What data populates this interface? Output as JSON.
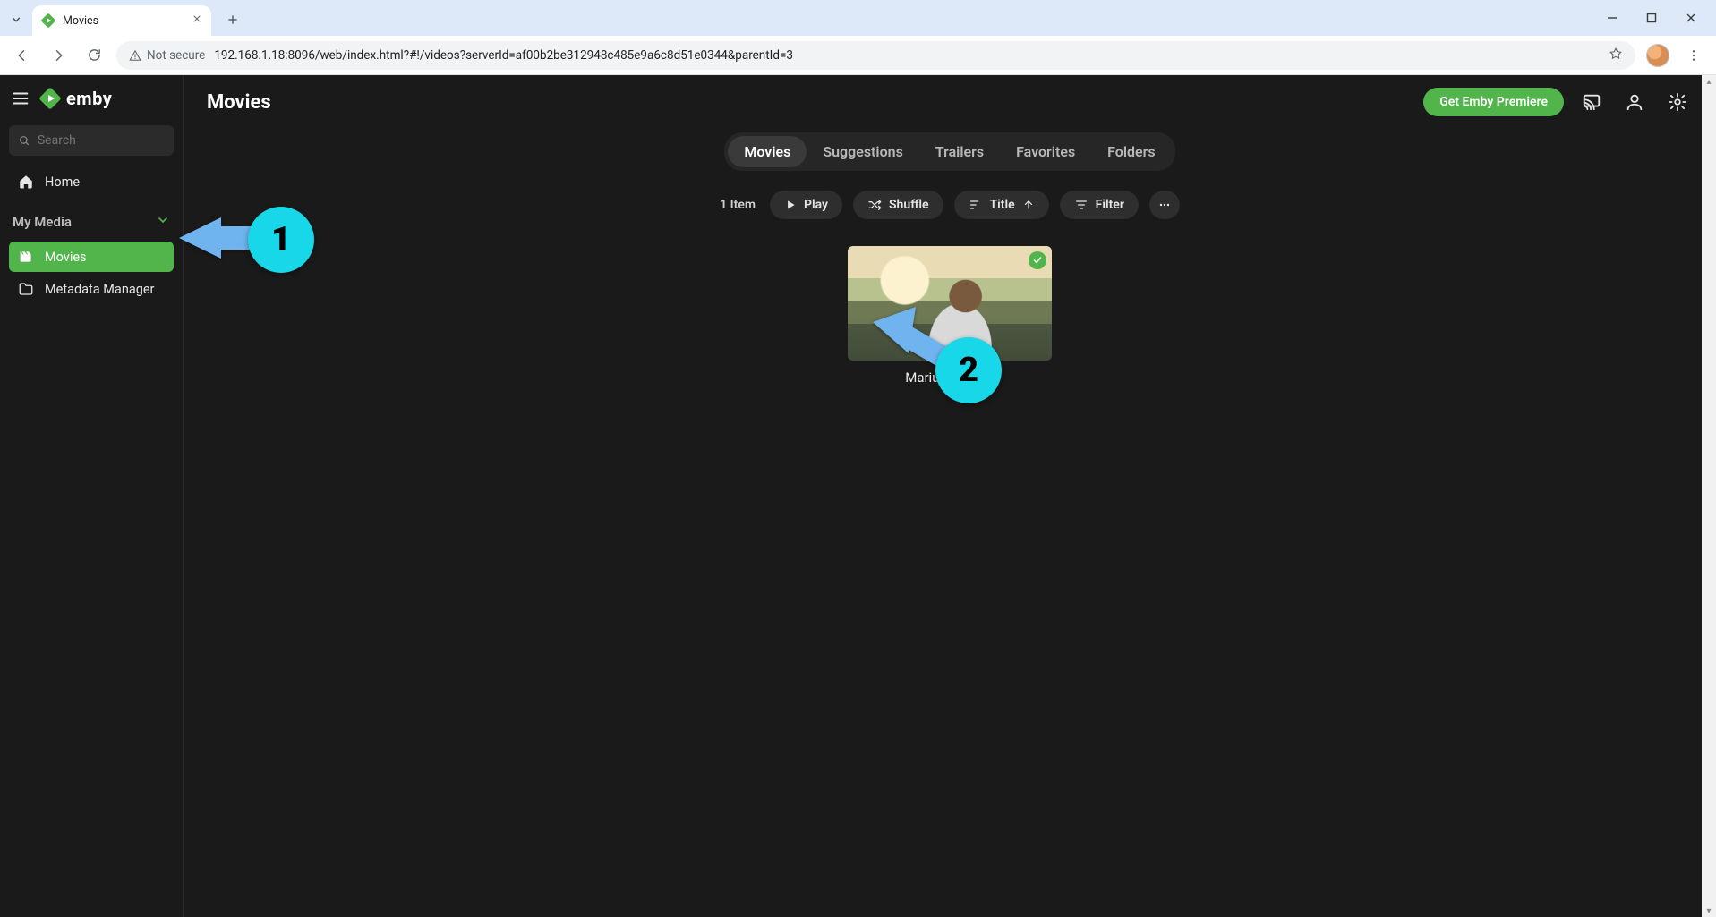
{
  "browser": {
    "tab_title": "Movies",
    "security_label": "Not secure",
    "url": "192.168.1.18:8096/web/index.html?#!/videos?serverId=af00b2be312948c485e9a6c8d51e0344&parentId=3"
  },
  "brand": {
    "name": "emby",
    "accent": "#52b54b"
  },
  "sidebar": {
    "search_placeholder": "Search",
    "home_label": "Home",
    "section_label": "My Media",
    "items": [
      {
        "label": "Movies"
      },
      {
        "label": "Metadata Manager"
      }
    ]
  },
  "header": {
    "title": "Movies",
    "premiere_label": "Get Emby Premiere"
  },
  "tabs": [
    {
      "label": "Movies",
      "active": true
    },
    {
      "label": "Suggestions"
    },
    {
      "label": "Trailers"
    },
    {
      "label": "Favorites"
    },
    {
      "label": "Folders"
    }
  ],
  "toolbar": {
    "count_label": "1 Item",
    "play_label": "Play",
    "shuffle_label": "Shuffle",
    "sort_label": "Title",
    "filter_label": "Filter"
  },
  "grid": {
    "items": [
      {
        "title": "Marius hosting",
        "watched": true
      }
    ]
  },
  "annotations": {
    "a1": "1",
    "a2": "2"
  }
}
